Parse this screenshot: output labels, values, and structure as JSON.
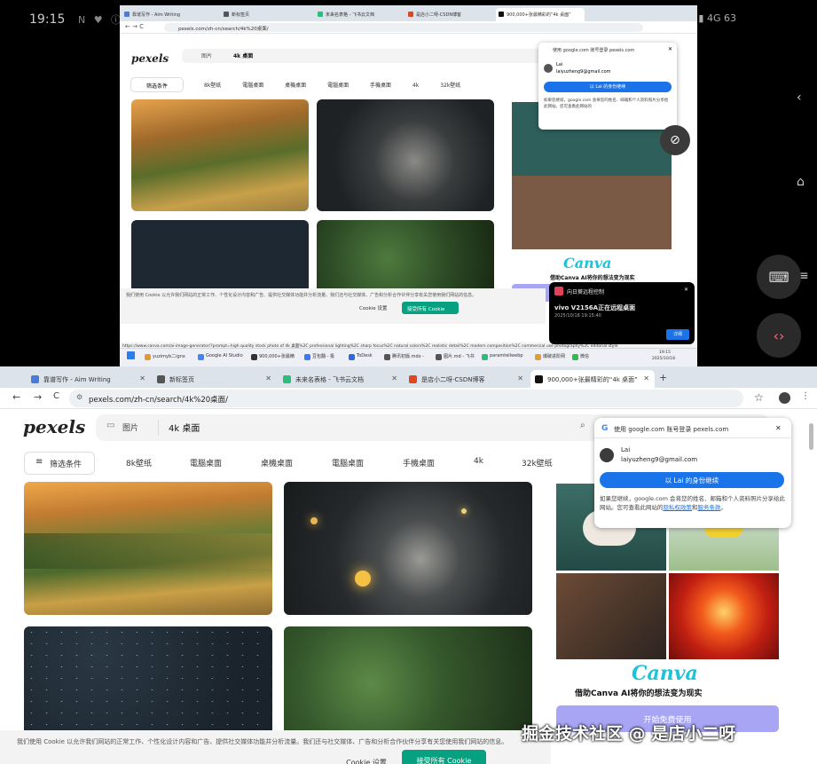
{
  "phone": {
    "time": "19:15",
    "status_left": "N ♥ ⓘ ·",
    "status_right": "⚙ ⚙ ⊘ ▮ 4G 63"
  },
  "tabs": [
    {
      "title": "靠谱写作 - Aim Writing",
      "color": "#4a7bd8"
    },
    {
      "title": "新标签页",
      "color": "#555"
    },
    {
      "title": "未来名表格 - 飞书云文档",
      "color": "#2dbd7a"
    },
    {
      "title": "是店小二呀-CSDN博客",
      "color": "#e0461f"
    },
    {
      "title": "900,000+张最精彩的“4k 桌面”",
      "color": "#111"
    }
  ],
  "tab_add": "+",
  "address": {
    "url": "pexels.com/zh-cn/search/4k%20桌面/",
    "back": "←",
    "forward": "→",
    "reload": "C",
    "star": "☆"
  },
  "site": {
    "logo": "pexels",
    "search_type": "图片",
    "search_query": "4k 桌面",
    "filter_label": "筛选条件",
    "categories": [
      "8k壁纸",
      "電腦桌面",
      "桌機桌面",
      "電腦桌面",
      "手機桌面",
      "4k",
      "32k壁纸"
    ],
    "photos": [
      {
        "name": "hills",
        "c1": "#b5752d",
        "c2": "#5d6b2a",
        "c3": "#e8b040"
      },
      {
        "name": "bulb",
        "c1": "#262a2d",
        "c2": "#5a5a58",
        "c3": "#f0c060"
      },
      {
        "name": "stars",
        "c1": "#1c2730",
        "c2": "#22323e",
        "c3": "#c9d4dc"
      },
      {
        "name": "leaves",
        "c1": "#23391f",
        "c2": "#4e7a3e",
        "c3": "#1a2a16"
      }
    ]
  },
  "ad": {
    "brand": "Canva",
    "tagline": "借助Canva AI将你的想法变为现实",
    "cta": "开始免费使用"
  },
  "google_popup": {
    "title": "使用 google.com 账号登录 pexels.com",
    "user_name": "Lai",
    "user_email": "laiyuzheng9@gmail.com",
    "continue_btn": "以 Lai 的身份继续",
    "fine_print": "如果您继续，google.com 会将您的姓名、邮箱和个人资料照片分享给此网站。您可查看此网站的",
    "link_privacy": "隐私权政策",
    "and_text": "和",
    "link_terms": "服务条款",
    "close": "✕",
    "end": "。"
  },
  "cookie": {
    "text": "我们使用 Cookie 以允许我们网站的正常工作、个性化设计内容和广告、提供社交媒体功能并分析流量。我们还与社交媒体、广告和分析合作伙伴分享有关您使用我们网站的信息。",
    "settings_btn": "Cookie 设置",
    "accept_btn": "接受所有 Cookie"
  },
  "notification": {
    "title": "向日葵远程控制",
    "message": "vivo V2156A正在远程桌面",
    "time": "2025/10/18 19:15:40",
    "btn": "详细"
  },
  "taskbar": {
    "items": [
      "yuzimyb二ignx",
      "Google AI Studio",
      "900,000+张最精",
      "豆包翻 - 极",
      "ToDesk",
      "腾讯初版.mdx -",
      "图片.md - 飞书",
      "paramtellwebp",
      "爆破进阶网",
      "微信"
    ],
    "clock_time": "19:15",
    "clock_date": "2025/10/18"
  },
  "status_link": "https://www.canva.com/ai-image-generator/?prompt=high quality stock photo of 4k 桌面%2C professional lighting%2C sharp focus%2C natural colors%2C realistic detail%2C modern composition%2C commercial use photography%2C editorial style",
  "watermark": "掘金技术社区 @ 是店小二呀",
  "icons": {
    "google": "google-icon",
    "image": "image-icon",
    "search": "search-icon",
    "close": "close-icon",
    "filter": "filter-icon",
    "keyboard": "keyboard-icon",
    "code": "code-icon",
    "home": "home-icon",
    "menu": "menu-icon",
    "back": "back-icon"
  }
}
